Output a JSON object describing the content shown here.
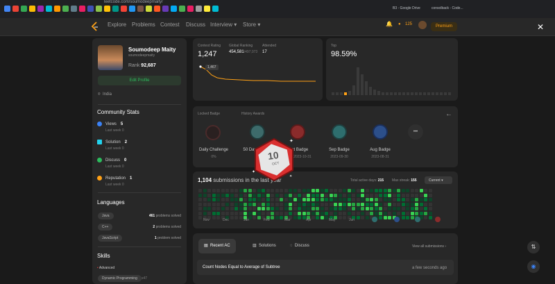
{
  "browser": {
    "url": "leetcode.com/soumodeepmaity/",
    "bookmarks": [
      "B3 - Google Drive",
      "consolback - Code..."
    ]
  },
  "nav": {
    "links": [
      "Explore",
      "Problems",
      "Contest",
      "Discuss",
      "Interview ▾",
      "Store ▾"
    ],
    "coins": "125",
    "premium": "Premium"
  },
  "profile": {
    "name": "Soumodeep Maity",
    "handle": "soumodeepmaity",
    "rank_label": "Rank",
    "rank_value": "92,687",
    "edit_button": "Edit Profile",
    "location": "India"
  },
  "community": {
    "title": "Community Stats",
    "items": [
      {
        "label": "Views",
        "value": "5",
        "sub": "Last week 0",
        "color": "#3b82f6"
      },
      {
        "label": "Solution",
        "value": "2",
        "sub": "Last week 0",
        "color": "#22d3ee"
      },
      {
        "label": "Discuss",
        "value": "0",
        "sub": "Last week 0",
        "color": "#2cbb5d"
      },
      {
        "label": "Reputation",
        "value": "1",
        "sub": "Last week 0",
        "color": "#ffa116"
      }
    ]
  },
  "languages": {
    "title": "Languages",
    "items": [
      {
        "name": "Java",
        "count": "461",
        "suffix": "problems solved"
      },
      {
        "name": "C++",
        "count": "2",
        "suffix": "problems solved"
      },
      {
        "name": "JavaScript",
        "count": "1",
        "suffix": "problem solved"
      }
    ]
  },
  "skills": {
    "title": "Skills",
    "level": "Advanced",
    "chip": "Dynamic Programming",
    "chip_count": "x47"
  },
  "contest": {
    "rating_label": "Contest Rating",
    "rating": "1,247",
    "global_label": "Global Ranking",
    "global": "454,581",
    "global_total": "/497,073",
    "attended_label": "Attended",
    "attended": "17",
    "point_label": "1,467",
    "top_label": "Top",
    "top_value": "98.59%"
  },
  "badges": {
    "locked_label": "Locked Badge",
    "history_label": "History Awards",
    "items": [
      {
        "name": "Daily Challenge",
        "sub": "0%"
      },
      {
        "name": "50 Days Badge",
        "sub": ""
      },
      {
        "name": "Oct Badge",
        "sub": "2023-10-31"
      },
      {
        "name": "Sep Badge",
        "sub": "2023-09-30"
      },
      {
        "name": "Aug Badge",
        "sub": "2023-08-31"
      }
    ],
    "more": "•••",
    "popup_number": "10",
    "popup_month": "OCT"
  },
  "submissions": {
    "count": "1,104",
    "suffix": "submissions in the last year",
    "active_label": "Total active days:",
    "active": "215",
    "streak_label": "Max streak:",
    "streak": "155",
    "dropdown": "Current",
    "months": [
      "Nov",
      "Dec",
      "Jan",
      "Feb",
      "Mar",
      "Apr",
      "May",
      "Jun"
    ]
  },
  "recent": {
    "tabs": [
      "Recent AC",
      "Solutions",
      "Discuss"
    ],
    "view_all": "View all submissions ›",
    "row_title": "Count Nodes Equal to Average of Subtree",
    "row_time": "a few seconds ago"
  },
  "colors": {
    "accent": "#ffa116",
    "green": "#2cbb5d",
    "card": "#282828"
  }
}
